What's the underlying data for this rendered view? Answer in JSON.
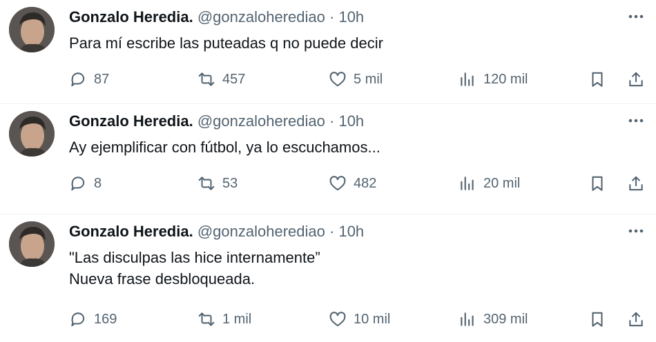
{
  "tweets": [
    {
      "author": "Gonzalo Heredia.",
      "handle": "@gonzaloherediao",
      "separator": "·",
      "time": "10h",
      "lines": [
        "Para mí escribe las puteadas q no puede decir"
      ],
      "replies": "87",
      "retweets": "457",
      "likes": "5 mil",
      "views": "120 mil"
    },
    {
      "author": "Gonzalo Heredia.",
      "handle": "@gonzaloherediao",
      "separator": "·",
      "time": "10h",
      "lines": [
        "Ay ejemplificar con fútbol, ya lo escuchamos..."
      ],
      "replies": "8",
      "retweets": "53",
      "likes": "482",
      "views": "20 mil"
    },
    {
      "author": "Gonzalo Heredia.",
      "handle": "@gonzaloherediao",
      "separator": "·",
      "time": "10h",
      "lines": [
        "\"Las disculpas las hice internamente”",
        "Nueva frase desbloqueada."
      ],
      "replies": "169",
      "retweets": "1 mil",
      "likes": "10 mil",
      "views": "309 mil"
    }
  ],
  "icons": {
    "reply": "reply-icon",
    "retweet": "retweet-icon",
    "like": "heart-icon",
    "views": "views-icon",
    "bookmark": "bookmark-icon",
    "share": "share-icon",
    "more": "more-icon"
  },
  "colors": {
    "text": "#0f1419",
    "secondary": "#536471",
    "divider": "#eff3f4"
  }
}
